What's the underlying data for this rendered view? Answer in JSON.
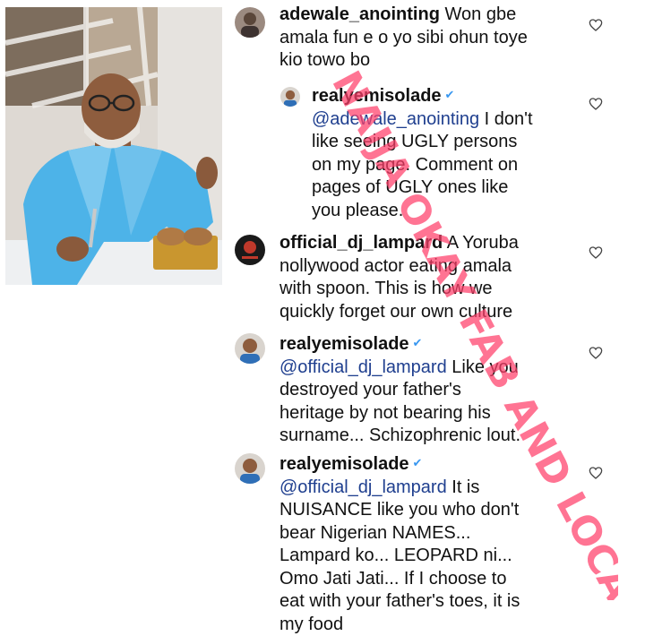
{
  "photo": {
    "alt_icon": "person-eating-photo"
  },
  "comments": [
    {
      "username": "adewale_anointing",
      "verified": false,
      "lines": [
        "Won gbe",
        "amala fun e o yo sibi ohun toye",
        "kio towo bo"
      ],
      "avatar": "avatar-adewale"
    },
    {
      "username": "realyemisolade",
      "verified": true,
      "mention": "@adewale_anointing",
      "lines": [
        "I don't",
        "like seeing UGLY persons",
        "on my page. Comment on",
        "pages of UGLY ones like",
        "you please."
      ],
      "avatar": "avatar-realyemisolade"
    },
    {
      "username": "official_dj_lampard",
      "verified": false,
      "lines": [
        "A Yoruba",
        "nollywood actor eating amala",
        "with spoon. This is how we",
        "quickly forget our own culture"
      ],
      "avatar": "avatar-dj-lampard"
    },
    {
      "username": "realyemisolade",
      "verified": true,
      "mention": "@official_dj_lampard",
      "lines": [
        "Like you",
        "destroyed your father's",
        "heritage by not bearing his",
        "surname... Schizophrenic lout."
      ],
      "avatar": "avatar-realyemisolade"
    },
    {
      "username": "realyemisolade",
      "verified": true,
      "mention": "@official_dj_lampard",
      "lines": [
        "It is",
        "NUISANCE like you who don't",
        "bear Nigerian NAMES...",
        "Lampard ko... LEOPARD ni...",
        "Omo Jati Jati... If I choose to",
        "eat with your father's toes, it is",
        "my food"
      ],
      "avatar": "avatar-realyemisolade"
    }
  ],
  "icons": {
    "like": "heart-icon",
    "verified": "verified-badge-icon"
  },
  "watermark": {
    "text": "NAIJA OKAY FAB AND LOCAL"
  },
  "colors": {
    "username": "#111111",
    "mention": "#1f3f8f",
    "verified": "#3897f0",
    "watermark": "#ff3f6a"
  }
}
